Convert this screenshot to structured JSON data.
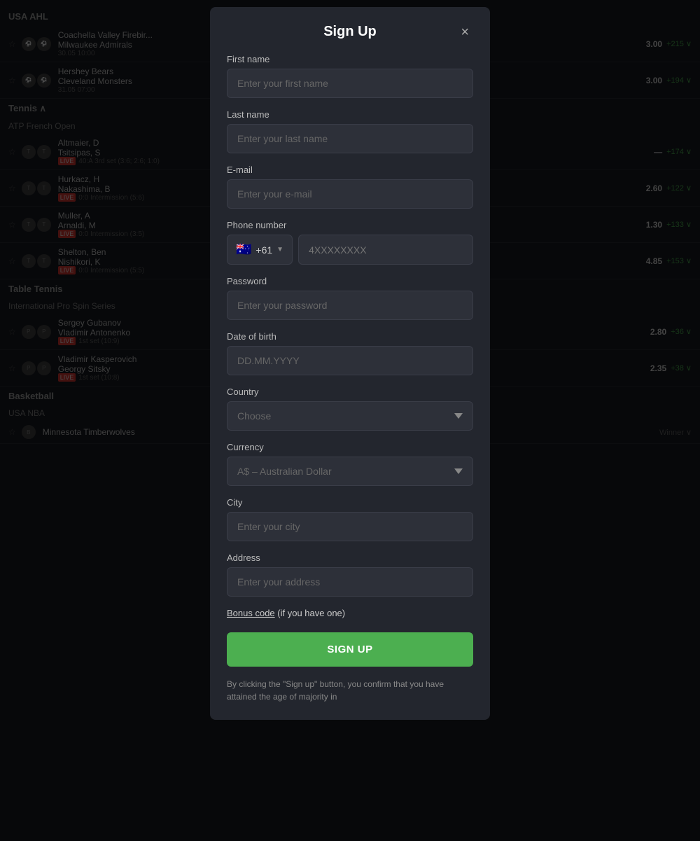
{
  "background": {
    "sections": [
      {
        "name": "USA AHL",
        "leagues": [
          {
            "name": "",
            "matches": [
              {
                "team1": "Coachella Valley Firebir...",
                "team2": "Milwaukee Admirals",
                "date": "30.05",
                "time": "10:00",
                "odds": "3.00",
                "change": "+215",
                "live": false
              },
              {
                "team1": "Hershey Bears",
                "team2": "Cleveland Monsters",
                "date": "31.05",
                "time": "07:00",
                "odds": "3.00",
                "change": "+194",
                "live": false
              }
            ]
          }
        ]
      },
      {
        "name": "Tennis",
        "leagues": [
          {
            "name": "ATP French Open",
            "matches": [
              {
                "team1": "Altmaier, D",
                "team2": "Tsitsipas, S",
                "info": "LIVE 40:A 3rd set (3:6; 2:6; 1:0)",
                "change": "+174",
                "live": true
              },
              {
                "team1": "Hurkacz, H",
                "team2": "Nakashima, B",
                "info": "LIVE 0:0 Intermission (5:6)",
                "odds": "2.60",
                "change": "+122",
                "live": true
              },
              {
                "team1": "Muller, A",
                "team2": "Arnaldi, M",
                "info": "LIVE 0:0 Intermission (3:5)",
                "odds": "1.30",
                "change": "+133",
                "live": true
              },
              {
                "team1": "Shelton, Ben",
                "team2": "Nishikori, K",
                "info": "LIVE 0:0 Intermission (5:5)",
                "odds": "4.85",
                "change": "+153",
                "live": true
              }
            ]
          }
        ]
      },
      {
        "name": "Table Tennis",
        "leagues": [
          {
            "name": "International Pro Spin Series",
            "matches": [
              {
                "team1": "Sergey Gubanov",
                "team2": "Vladimir Antonenko",
                "info": "LIVE 1st set (10:9)",
                "odds": "2.80",
                "change": "+36",
                "live": true
              },
              {
                "team1": "Vladimir Kasperovich",
                "team2": "Georgy Sitsky",
                "info": "LIVE 1st set (10:8)",
                "odds": "2.35",
                "change": "+38",
                "live": true
              }
            ]
          }
        ]
      },
      {
        "name": "Basketball",
        "leagues": [
          {
            "name": "USA NBA",
            "matches": [
              {
                "team1": "Minnesota Timberwolves",
                "team2": "",
                "live": false
              }
            ]
          }
        ]
      }
    ]
  },
  "modal": {
    "title": "Sign Up",
    "close_label": "×",
    "fields": {
      "first_name_label": "First name",
      "first_name_placeholder": "Enter your first name",
      "last_name_label": "Last name",
      "last_name_placeholder": "Enter your last name",
      "email_label": "E-mail",
      "email_placeholder": "Enter your e-mail",
      "phone_label": "Phone number",
      "phone_flag": "🇦🇺",
      "phone_code": "+61",
      "phone_placeholder": "4XXXXXXXX",
      "password_label": "Password",
      "password_placeholder": "Enter your password",
      "dob_label": "Date of birth",
      "dob_placeholder": "DD.MM.YYYY",
      "country_label": "Country",
      "country_placeholder": "Choose",
      "currency_label": "Currency",
      "currency_value": "A$ – Australian Dollar",
      "city_label": "City",
      "city_placeholder": "Enter your city",
      "address_label": "Address",
      "address_placeholder": "Enter your address"
    },
    "bonus_code_link": "Bonus code",
    "bonus_code_suffix": " (if you have one)",
    "signup_button": "SIGN UP",
    "terms_text": "By clicking the \"Sign up\" button, you confirm that you have attained the age of majority in"
  }
}
